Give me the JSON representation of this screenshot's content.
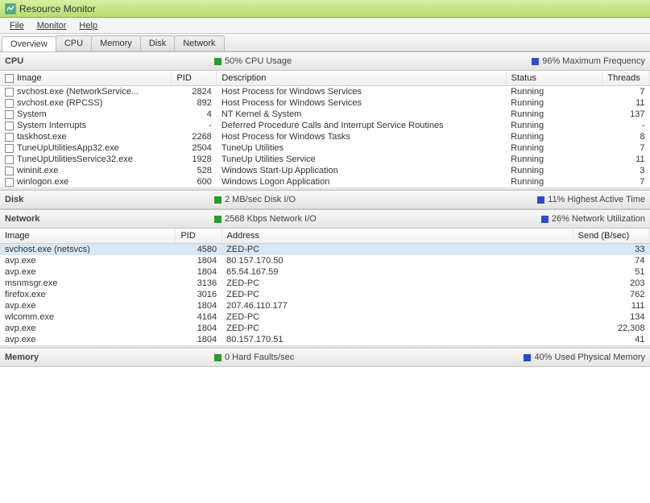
{
  "window": {
    "title": "Resource Monitor"
  },
  "menu": {
    "file": "File",
    "monitor": "Monitor",
    "help": "Help"
  },
  "tabs": {
    "overview": "Overview",
    "cpu": "CPU",
    "memory": "Memory",
    "disk": "Disk",
    "network": "Network"
  },
  "cpu_section": {
    "title": "CPU",
    "usage_label": "50% CPU Usage",
    "freq_label": "96% Maximum Frequency",
    "cols": {
      "image": "Image",
      "pid": "PID",
      "desc": "Description",
      "status": "Status",
      "threads": "Threads"
    },
    "rows": [
      {
        "image": "svchost.exe (NetworkService...",
        "pid": "2824",
        "desc": "Host Process for Windows Services",
        "status": "Running",
        "threads": "7"
      },
      {
        "image": "svchost.exe (RPCSS)",
        "pid": "892",
        "desc": "Host Process for Windows Services",
        "status": "Running",
        "threads": "11"
      },
      {
        "image": "System",
        "pid": "4",
        "desc": "NT Kernel & System",
        "status": "Running",
        "threads": "137"
      },
      {
        "image": "System Interrupts",
        "pid": "-",
        "desc": "Deferred Procedure Calls and Interrupt Service Routines",
        "status": "Running",
        "threads": "-"
      },
      {
        "image": "taskhost.exe",
        "pid": "2268",
        "desc": "Host Process for Windows Tasks",
        "status": "Running",
        "threads": "8"
      },
      {
        "image": "TuneUpUtilitiesApp32.exe",
        "pid": "2504",
        "desc": "TuneUp Utilities",
        "status": "Running",
        "threads": "7"
      },
      {
        "image": "TuneUpUtilitiesService32.exe",
        "pid": "1928",
        "desc": "TuneUp Utilities Service",
        "status": "Running",
        "threads": "11"
      },
      {
        "image": "wininit.exe",
        "pid": "528",
        "desc": "Windows Start-Up Application",
        "status": "Running",
        "threads": "3"
      },
      {
        "image": "winlogon.exe",
        "pid": "600",
        "desc": "Windows Logon Application",
        "status": "Running",
        "threads": "7"
      }
    ]
  },
  "disk_section": {
    "title": "Disk",
    "io_label": "2 MB/sec Disk I/O",
    "active_label": "11% Highest Active Time"
  },
  "network_section": {
    "title": "Network",
    "io_label": "2568 Kbps Network I/O",
    "util_label": "26% Network Utilization",
    "cols": {
      "image": "Image",
      "pid": "PID",
      "address": "Address",
      "send": "Send (B/sec)"
    },
    "rows": [
      {
        "image": "svchost.exe (netsvcs)",
        "pid": "4580",
        "addr": "ZED-PC",
        "send": "33",
        "sel": true
      },
      {
        "image": "avp.exe",
        "pid": "1804",
        "addr": "80.157.170.50",
        "send": "74"
      },
      {
        "image": "avp.exe",
        "pid": "1804",
        "addr": "65.54.167.59",
        "send": "51"
      },
      {
        "image": "msnmsgr.exe",
        "pid": "3136",
        "addr": "ZED-PC",
        "send": "203"
      },
      {
        "image": "firefox.exe",
        "pid": "3016",
        "addr": "ZED-PC",
        "send": "762"
      },
      {
        "image": "avp.exe",
        "pid": "1804",
        "addr": "207.46.110.177",
        "send": "111"
      },
      {
        "image": "wlcomm.exe",
        "pid": "4164",
        "addr": "ZED-PC",
        "send": "134"
      },
      {
        "image": "avp.exe",
        "pid": "1804",
        "addr": "ZED-PC",
        "send": "22,308"
      },
      {
        "image": "avp.exe",
        "pid": "1804",
        "addr": "80.157.170.51",
        "send": "41"
      }
    ]
  },
  "memory_section": {
    "title": "Memory",
    "faults_label": "0 Hard Faults/sec",
    "used_label": "40% Used Physical Memory"
  }
}
